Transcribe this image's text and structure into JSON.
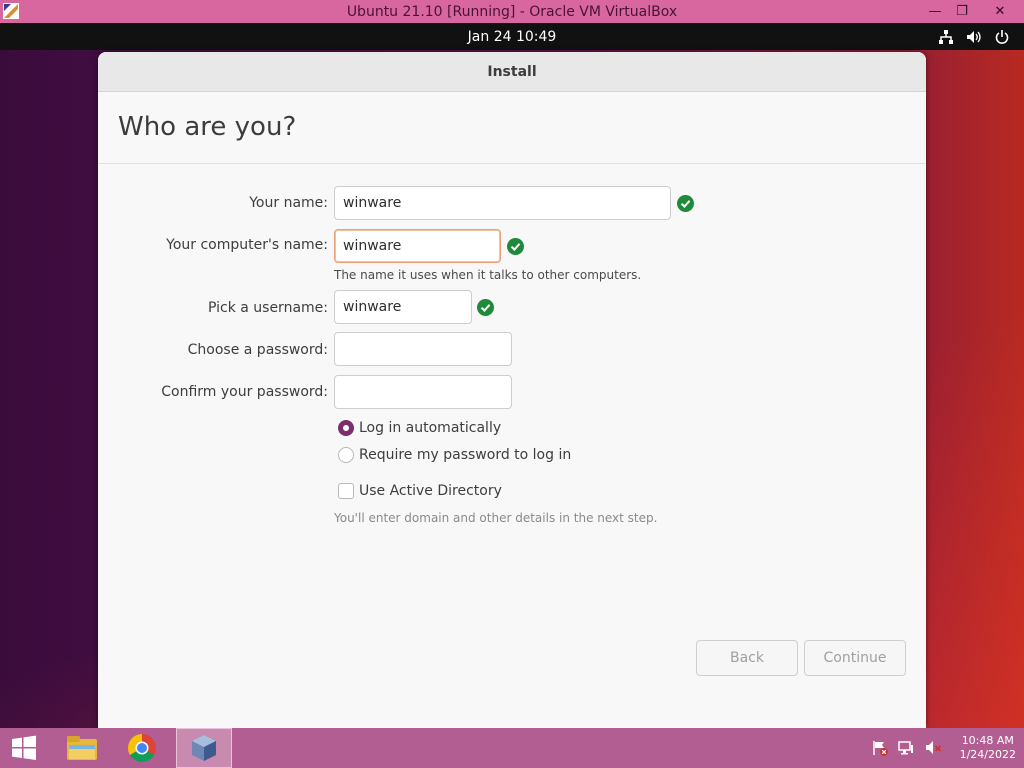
{
  "vbox": {
    "title": "Ubuntu 21.10 [Running] - Oracle VM VirtualBox",
    "minimize": "—",
    "restore": "❐",
    "close": "✕"
  },
  "topbar": {
    "datetime": "Jan 24  10:49"
  },
  "installer": {
    "window_title": "Install",
    "page_title": "Who are you?",
    "name": {
      "label": "Your name:",
      "value": "winware"
    },
    "computer": {
      "label": "Your computer's name:",
      "value": "winware",
      "hint": "The name it uses when it talks to other computers."
    },
    "username": {
      "label": "Pick a username:",
      "value": "winware"
    },
    "password": {
      "label": "Choose a password:",
      "value": ""
    },
    "confirm": {
      "label": "Confirm your password:",
      "value": ""
    },
    "login_auto": {
      "label": "Log in automatically",
      "checked": true
    },
    "login_password": {
      "label": "Require my password to log in",
      "checked": false
    },
    "active_directory": {
      "label": "Use Active Directory",
      "checked": false,
      "hint": "You'll enter domain and other details in the next step."
    },
    "back_label": "Back",
    "continue_label": "Continue"
  },
  "taskbar": {
    "clock_time": "10:48 AM",
    "clock_date": "1/24/2022"
  },
  "colors": {
    "accent": "#7a2e6e",
    "check_green": "#1f8b3a",
    "taskbar": "#b25e92",
    "vbox_title": "#d8679f"
  }
}
